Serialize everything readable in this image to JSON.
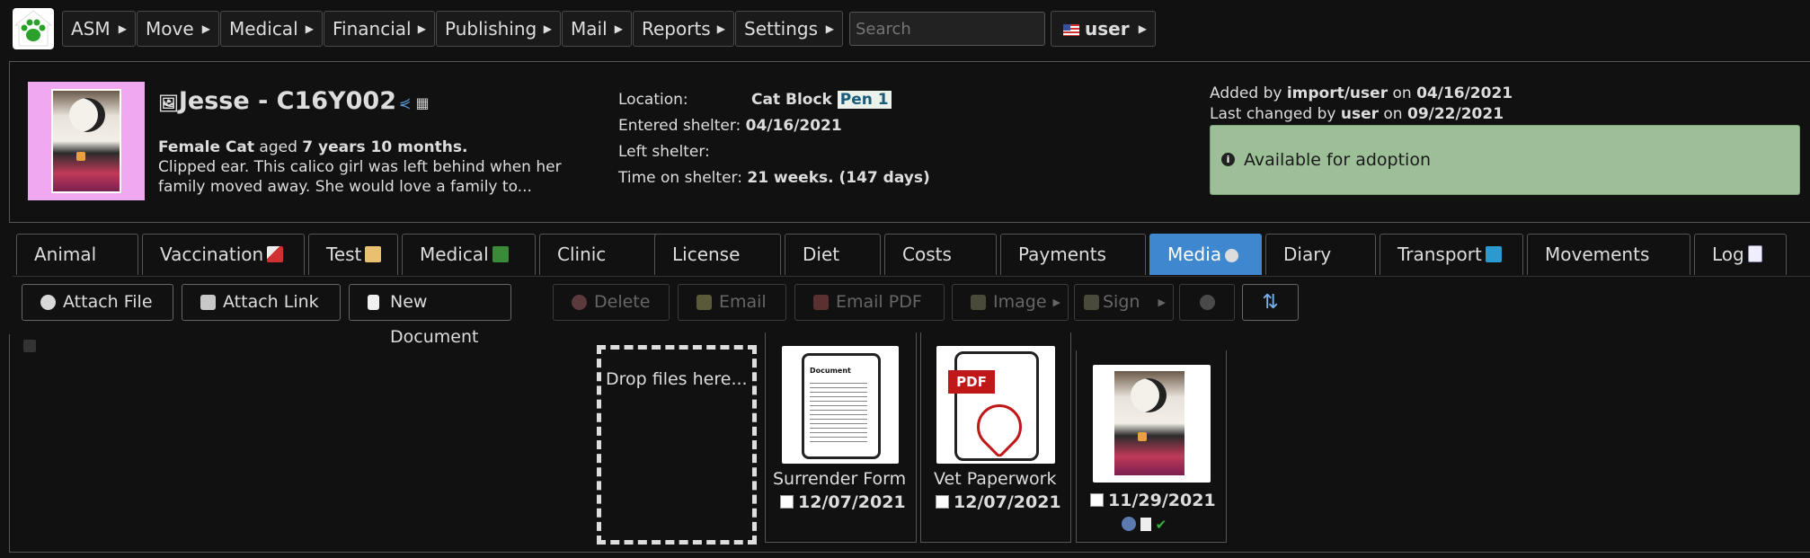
{
  "menu": {
    "items": [
      {
        "label": "ASM"
      },
      {
        "label": "Move"
      },
      {
        "label": "Medical"
      },
      {
        "label": "Financial"
      },
      {
        "label": "Publishing"
      },
      {
        "label": "Mail"
      },
      {
        "label": "Reports"
      },
      {
        "label": "Settings"
      }
    ],
    "search_placeholder": "Search",
    "user_label": "user"
  },
  "animal": {
    "name": "Jesse - C16Y002",
    "sex_species": "Female Cat",
    "aged_word": "aged",
    "age": "7 years 10 months.",
    "description": "Clipped ear. This calico girl was left behind when her family moved away. She would love a family to...",
    "location_label": "Location:",
    "location_value": "Cat Block",
    "pen": "Pen 1",
    "entered_label": "Entered shelter:",
    "entered_value": "04/16/2021",
    "left_label": "Left shelter:",
    "left_value": "",
    "time_label": "Time on shelter:",
    "time_value": "21 weeks. (147 days)",
    "added_prefix": "Added by",
    "added_by": "import/user",
    "on_word": "on",
    "added_date": "04/16/2021",
    "changed_prefix": "Last changed by",
    "changed_by": "user",
    "changed_date": "09/22/2021",
    "status": "Available for adoption"
  },
  "tabs": [
    {
      "label": "Animal"
    },
    {
      "label": "Vaccination"
    },
    {
      "label": "Test"
    },
    {
      "label": "Medical"
    },
    {
      "label": "Clinic"
    },
    {
      "label": "License"
    },
    {
      "label": "Diet"
    },
    {
      "label": "Costs"
    },
    {
      "label": "Payments"
    },
    {
      "label": "Media"
    },
    {
      "label": "Diary"
    },
    {
      "label": "Transport"
    },
    {
      "label": "Movements"
    },
    {
      "label": "Log"
    }
  ],
  "toolbar": {
    "attach_file": "Attach File",
    "attach_link": "Attach Link",
    "new_document": "New Document",
    "delete": "Delete",
    "email": "Email",
    "email_pdf": "Email PDF",
    "image": "Image",
    "sign": "Sign"
  },
  "media": {
    "drop_text": "Drop files here...",
    "items": [
      {
        "title": "Surrender Form",
        "date": "12/07/2021",
        "thumb_label": "Document"
      },
      {
        "title": "Vet Paperwork",
        "date": "12/07/2021",
        "thumb_label": "PDF"
      },
      {
        "title": "",
        "date": "11/29/2021"
      }
    ]
  },
  "colors": {
    "active_tab": "#3f88d0",
    "status_bg": "#9dbf98",
    "photo_border": "#f0a8f0"
  }
}
